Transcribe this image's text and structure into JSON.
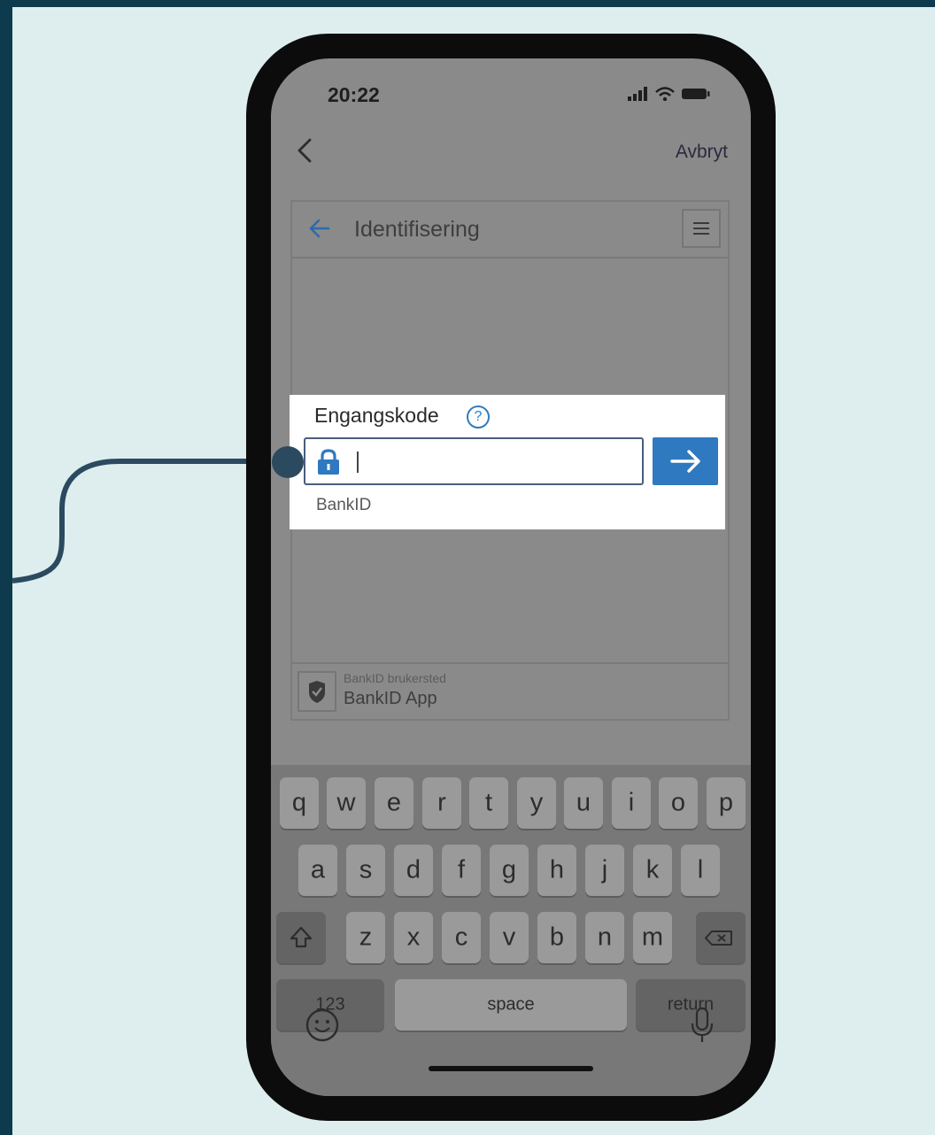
{
  "status_bar": {
    "time": "20:22"
  },
  "nav_bar": {
    "cancel_label": "Avbryt"
  },
  "webview": {
    "title": "Identifisering",
    "footer": {
      "small_text": "BankID brukersted",
      "main_text": "BankID App"
    }
  },
  "login_box": {
    "label": "Engangskode",
    "help_symbol": "?",
    "input_value": "",
    "brand": "BankID"
  },
  "keyboard": {
    "row1": [
      "q",
      "w",
      "e",
      "r",
      "t",
      "y",
      "u",
      "i",
      "o",
      "p"
    ],
    "row2": [
      "a",
      "s",
      "d",
      "f",
      "g",
      "h",
      "j",
      "k",
      "l"
    ],
    "row3": [
      "z",
      "x",
      "c",
      "v",
      "b",
      "n",
      "m"
    ],
    "numbers_label": "123",
    "space_label": "space",
    "return_label": "return"
  },
  "colors": {
    "accent": "#2f79c0",
    "page_border": "#0d3a4c",
    "canvas": "#deeeee"
  }
}
